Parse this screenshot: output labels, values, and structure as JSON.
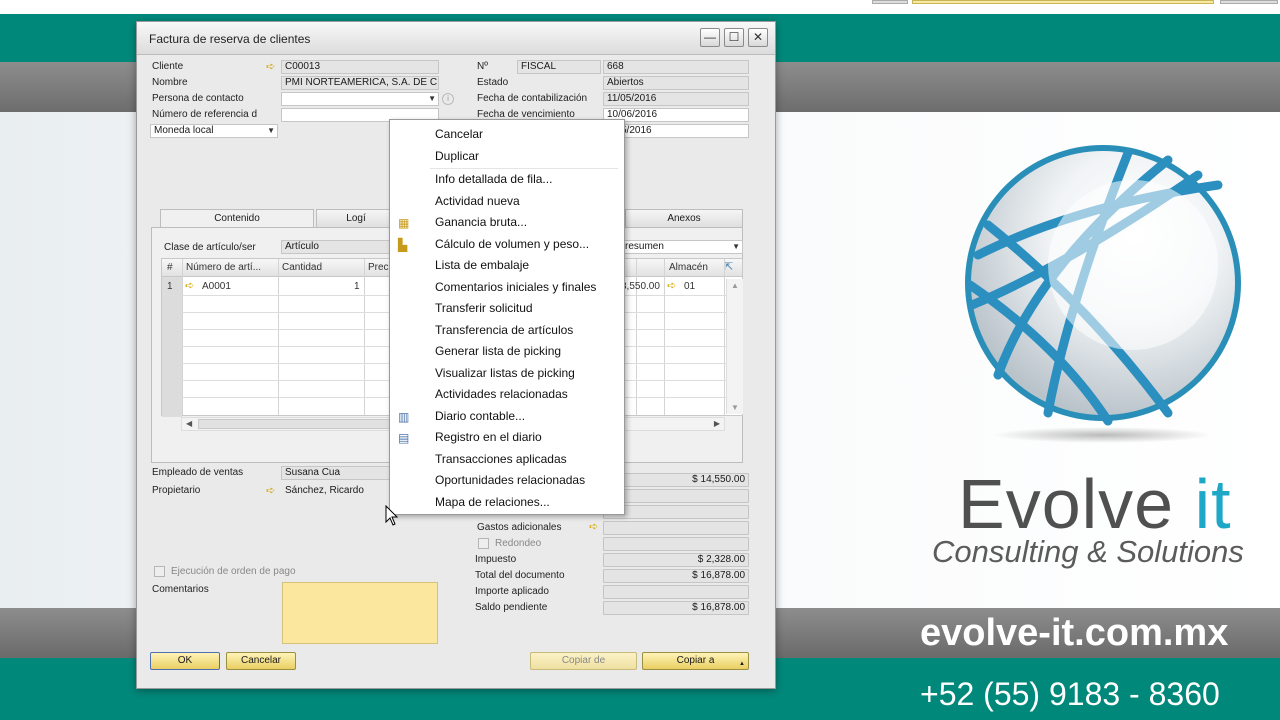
{
  "window": {
    "title": "Factura de reserva de clientes",
    "minimize": "—",
    "maximize": "☐",
    "close": "✕"
  },
  "header_left": {
    "cliente_label": "Cliente",
    "cliente_value": "C00013",
    "nombre_label": "Nombre",
    "nombre_value": "PMI NORTEAMERICA, S.A. DE C",
    "contacto_label": "Persona de contacto",
    "contacto_value": "",
    "referencia_label": "Número de referencia d",
    "referencia_value": "",
    "moneda_value": "Moneda local"
  },
  "header_right": {
    "no_label": "Nº",
    "serie_value": "FISCAL",
    "numero_value": "668",
    "estado_label": "Estado",
    "estado_value": "Abiertos",
    "fecha_cont_label": "Fecha de contabilización",
    "fecha_cont_value": "11/05/2016",
    "fecha_venc_label": "Fecha de vencimiento",
    "fecha_venc_value": "10/06/2016",
    "fecha_doc_value": "5/2016"
  },
  "tabs": [
    {
      "label": "Contenido"
    },
    {
      "label": "Logí"
    },
    {
      "label": "Anexos"
    }
  ],
  "content": {
    "clase_label": "Clase de artículo/ser",
    "clase_value": "Artículo",
    "resumen_value": "resumen",
    "columns": {
      "num": "#",
      "articulo": "Número de artí...",
      "cantidad": "Cantidad",
      "precio": "Prec",
      "almacen": "Almacén"
    },
    "row1": {
      "num": "1",
      "articulo": "A0001",
      "cantidad": "1",
      "total": "3,550.00",
      "almacen": "01"
    }
  },
  "footer_left": {
    "empleado_label": "Empleado de ventas",
    "empleado_value": "Susana Cua",
    "propietario_label": "Propietario",
    "propietario_value": "Sánchez, Ricardo",
    "ejecucion_label": "Ejecución de orden de pago",
    "comentarios_label": "Comentarios"
  },
  "totals": {
    "subtotal_value": "$ 14,550.00",
    "gastos_label": "Gastos adicionales",
    "redondeo_label": "Redondeo",
    "impuesto_label": "Impuesto",
    "impuesto_value": "$ 2,328.00",
    "total_label": "Total del documento",
    "total_value": "$ 16,878.00",
    "importe_label": "Importe aplicado",
    "importe_value": "",
    "saldo_label": "Saldo pendiente",
    "saldo_value": "$ 16,878.00"
  },
  "buttons": {
    "ok": "OK",
    "cancelar": "Cancelar",
    "copiar_de": "Copiar de",
    "copiar_a": "Copiar a"
  },
  "context_menu": {
    "items": [
      {
        "label": "Cancelar"
      },
      {
        "label": "Duplicar"
      },
      {
        "label": "Info detallada de fila..."
      },
      {
        "label": "Actividad nueva"
      },
      {
        "label": "Ganancia bruta..."
      },
      {
        "label": "Cálculo de volumen y peso..."
      },
      {
        "label": "Lista de embalaje"
      },
      {
        "label": "Comentarios iniciales y finales"
      },
      {
        "label": "Transferir solicitud"
      },
      {
        "label": "Transferencia de artículos"
      },
      {
        "label": "Generar lista de picking"
      },
      {
        "label": "Visualizar listas de picking"
      },
      {
        "label": "Actividades relacionadas"
      },
      {
        "label": "Diario contable..."
      },
      {
        "label": "Registro en el diario"
      },
      {
        "label": "Transacciones aplicadas"
      },
      {
        "label": "Oportunidades relacionadas"
      },
      {
        "label": "Mapa de relaciones..."
      }
    ]
  },
  "branding": {
    "brand_word1": "Evolve",
    "brand_word2": "it",
    "tagline": "Consulting & Solutions",
    "website": "evolve-it.com.mx",
    "phone": "+52 (55) 9183 - 8360"
  },
  "colors": {
    "teal": "#00897b",
    "brand_blue": "#1ea7c7",
    "button_yellow": "#e9cf62"
  }
}
